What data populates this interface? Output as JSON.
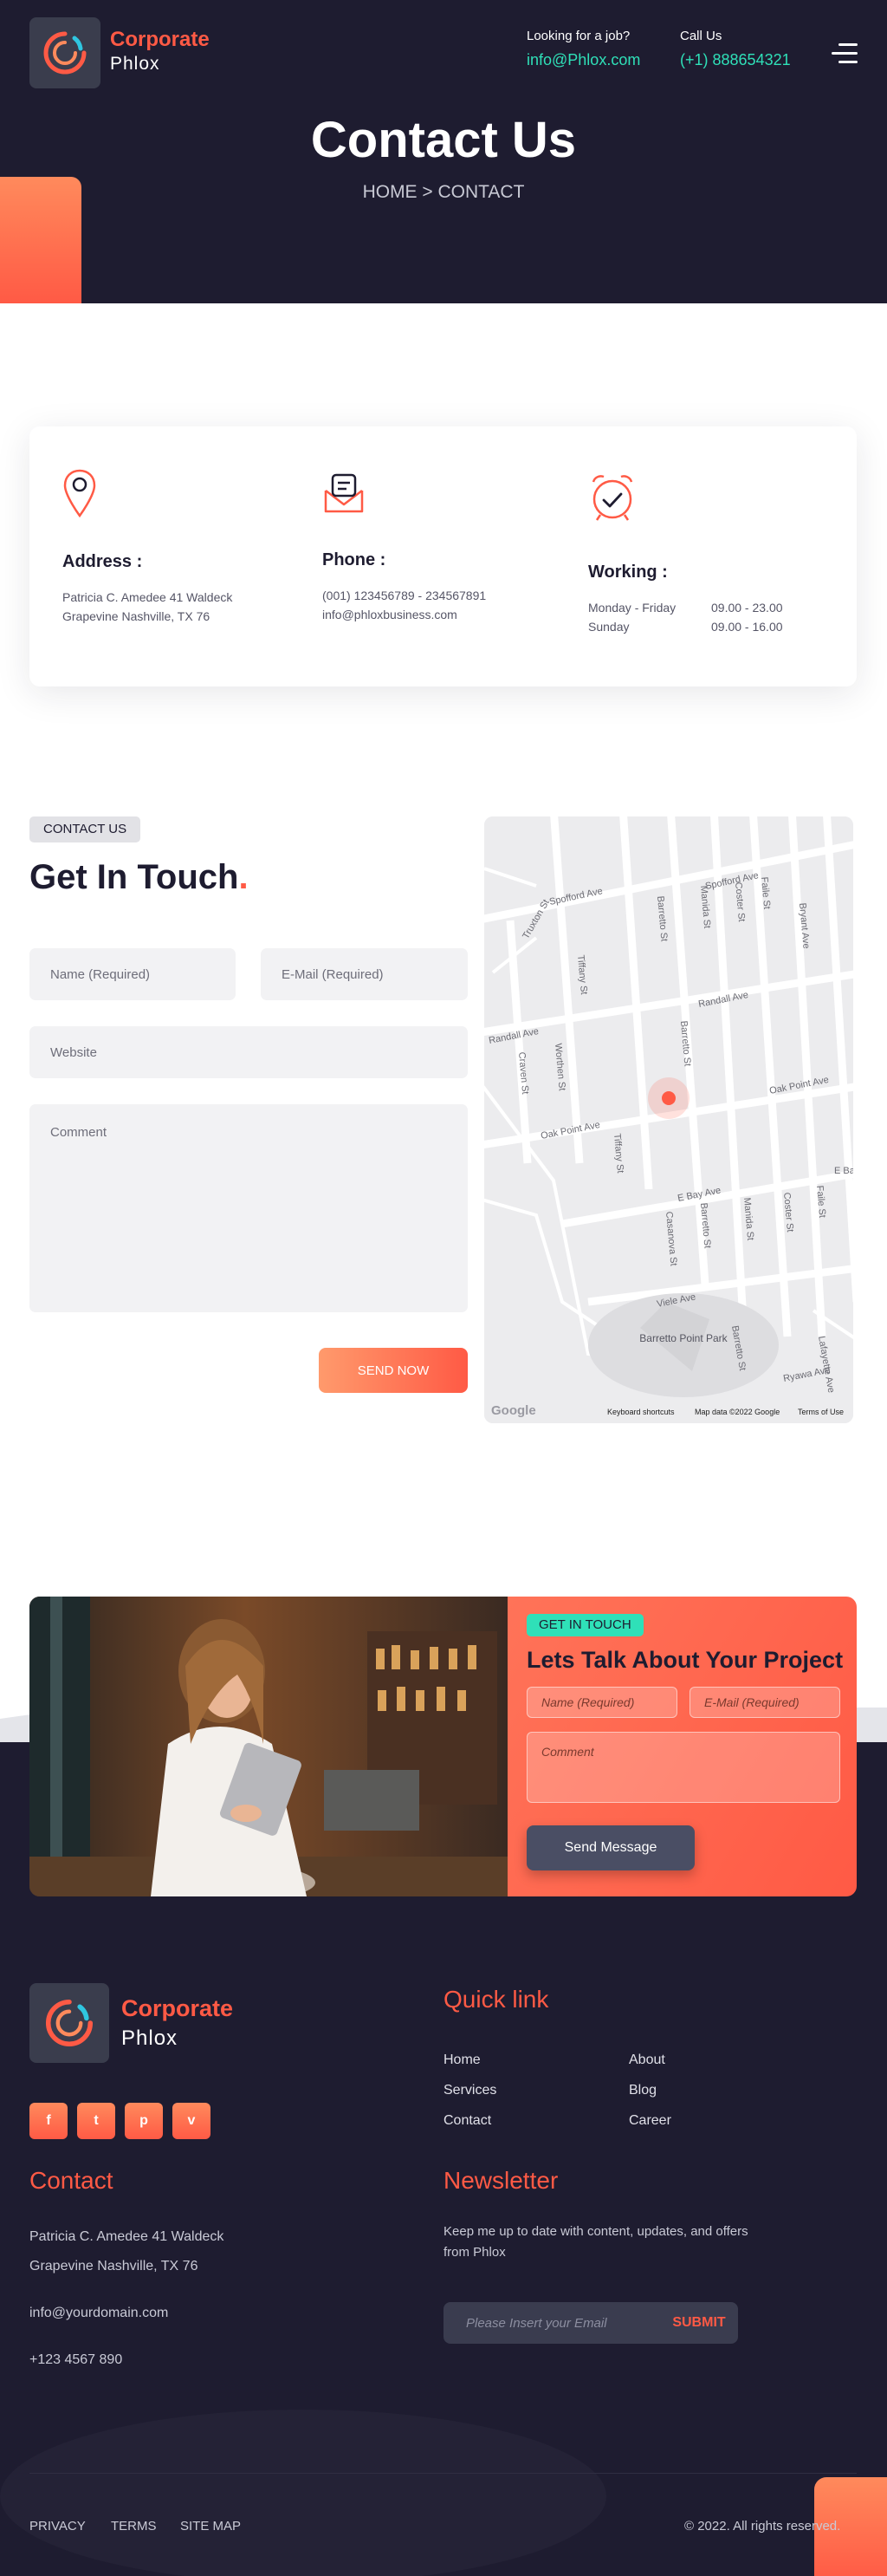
{
  "header": {
    "logo_title": "Corporate",
    "logo_subtitle": "Phlox",
    "job_label": "Looking for a job?",
    "job_email": "info@Phlox.com",
    "call_label": "Call Us",
    "call_phone": "(+1) 888654321",
    "menu_icon": "hamburger-menu-icon"
  },
  "hero": {
    "title": "Contact Us",
    "breadcrumb": "HOME > CONTACT"
  },
  "info": {
    "address": {
      "icon": "location-pin-icon",
      "title": "Address :",
      "line1": "Patricia C. Amedee 41 Waldeck",
      "line2": "Grapevine Nashville, TX 76"
    },
    "phone": {
      "icon": "envelope-icon",
      "title": "Phone :",
      "line1": "(001) 123456789 - 234567891",
      "line2": "info@phloxbusiness.com"
    },
    "working": {
      "icon": "alarm-clock-icon",
      "title": "Working :",
      "rows": [
        {
          "days": "Monday - Friday",
          "hours": "09.00 - 23.00"
        },
        {
          "days": "Sunday",
          "hours": "09.00 - 16.00"
        }
      ]
    }
  },
  "contact_form": {
    "tag": "CONTACT US",
    "title": "Get In Touch",
    "title_dot": ".",
    "name_placeholder": "Name (Required)",
    "email_placeholder": "E-Mail (Required)",
    "website_placeholder": "Website",
    "comment_placeholder": "Comment",
    "submit": "SEND NOW"
  },
  "map": {
    "streets": [
      "Spofford Ave",
      "Randall Ave",
      "Oak Point Ave",
      "Barretto St",
      "Manida St",
      "Coster St",
      "Faile St",
      "Bryant Ave",
      "Tiffany St",
      "Truxton St",
      "Worthen St",
      "Craven St",
      "E Bay Ave",
      "Casanova St",
      "Viele Ave",
      "Ryawa Ave",
      "Lafayette Ave"
    ],
    "park": "Barretto Point Park",
    "google": "Google",
    "footer_shortcuts": "Keyboard shortcuts",
    "footer_data": "Map data ©2022 Google",
    "footer_terms": "Terms of Use"
  },
  "cta": {
    "tag": "GET IN TOUCH",
    "title": "Lets Talk About Your Project",
    "name_placeholder": "Name (Required)",
    "email_placeholder": "E-Mail (Required)",
    "comment_placeholder": "Comment",
    "button": "Send Message"
  },
  "footer": {
    "logo_title": "Corporate",
    "logo_subtitle": "Phlox",
    "social": [
      {
        "icon": "facebook-icon",
        "glyph": "f"
      },
      {
        "icon": "twitter-icon",
        "glyph": "t"
      },
      {
        "icon": "pinterest-icon",
        "glyph": "p"
      },
      {
        "icon": "vimeo-icon",
        "glyph": "v"
      }
    ],
    "quick_link_title": "Quick link",
    "links": [
      "Home",
      "About",
      "Services",
      "Blog",
      "Contact",
      "Career"
    ],
    "contact_title": "Contact",
    "contact_line1": "Patricia C. Amedee 41 Waldeck",
    "contact_line2": "Grapevine Nashville, TX 76",
    "contact_email": "info@yourdomain.com",
    "contact_phone": "+123 4567 890",
    "newsletter_title": "Newsletter",
    "newsletter_text1": "Keep me up to date with content, updates, and offers",
    "newsletter_text2": "from Phlox",
    "newsletter_placeholder": "Please Insert your Email",
    "newsletter_button": "SUBMIT",
    "bottom_links": [
      "PRIVACY",
      "TERMS",
      "SITE MAP"
    ],
    "copyright": "© 2022. All rights reserved."
  },
  "colors": {
    "accent": "#ff5a45",
    "teal": "#2fe0b8",
    "dark": "#1e1c30"
  }
}
